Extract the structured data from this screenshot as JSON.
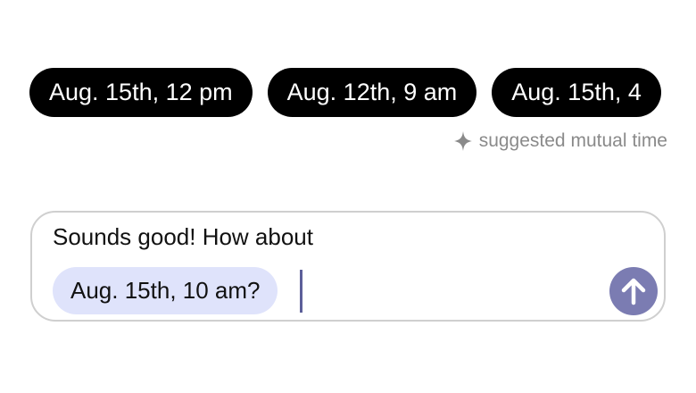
{
  "suggested_times": [
    {
      "label": "Aug. 15th, 12 pm"
    },
    {
      "label": "Aug. 12th, 9 am"
    },
    {
      "label": "Aug. 15th, 4"
    }
  ],
  "suggestion_note": {
    "icon": "sparkle-icon",
    "text": "suggested mutual time"
  },
  "composer": {
    "message_text": "Sounds good! How about",
    "inserted_time_chip": "Aug. 15th, 10 am?",
    "send_icon": "arrow-up-icon"
  },
  "colors": {
    "chip_background": "#000000",
    "chip_text": "#ffffff",
    "inline_chip_background": "#dfe3fb",
    "send_button": "#7b7cb2",
    "caret": "#5c5f99",
    "note_text": "#8a8a8a",
    "composer_border": "#cfcfcf"
  }
}
